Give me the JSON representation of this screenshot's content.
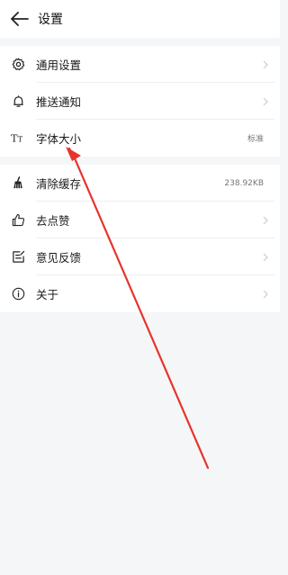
{
  "header": {
    "title": "设置"
  },
  "group1": [
    {
      "label": "通用设置",
      "icon": "gear-icon"
    },
    {
      "label": "推送通知",
      "icon": "bell-icon"
    },
    {
      "label": "字体大小",
      "icon": "font-size-icon",
      "value": "标准"
    }
  ],
  "group2": [
    {
      "label": "清除缓存",
      "icon": "broom-icon",
      "value": "238.92KB"
    },
    {
      "label": "去点赞",
      "icon": "thumbs-up-icon"
    },
    {
      "label": "意见反馈",
      "icon": "feedback-icon"
    },
    {
      "label": "关于",
      "icon": "info-icon"
    }
  ],
  "colors": {
    "annotation_arrow": "#e8332b",
    "background": "#f5f6f8"
  }
}
